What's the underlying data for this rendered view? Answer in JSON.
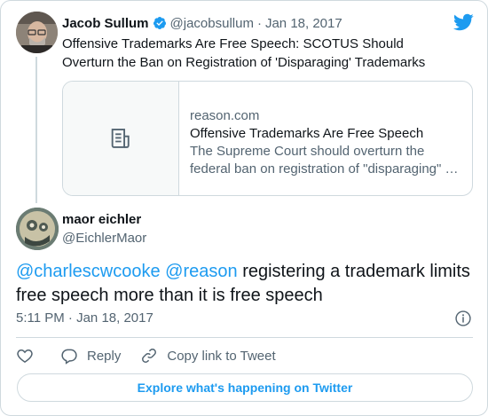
{
  "parent_tweet": {
    "author_name": "Jacob Sullum",
    "handle": "@jacobsullum",
    "separator": "·",
    "date": "Jan 18, 2017",
    "text": "Offensive Trademarks Are Free Speech: SCOTUS Should Overturn the Ban on Registration of 'Disparaging' Trademarks",
    "verified": true,
    "link_card": {
      "domain": "reason.com",
      "title": "Offensive Trademarks Are Free Speech",
      "description_line1": "The Supreme Court should overturn the",
      "description_line2": "federal ban on registration of \"disparaging\" …",
      "thumbnail_icon": "article-icon"
    }
  },
  "main_tweet": {
    "author_name": "maor eichler",
    "handle": "@EichlerMaor",
    "mentions": [
      "@charlescwcooke",
      "@reason"
    ],
    "text": "registering a trademark limits free speech more than it is free speech",
    "time": "5:11 PM",
    "separator": "·",
    "date": "Jan 18, 2017"
  },
  "actions": {
    "like_icon": "heart-icon",
    "reply_label": "Reply",
    "copy_link_label": "Copy link to Tweet"
  },
  "footer": {
    "explore_label": "Explore what's happening on Twitter"
  },
  "colors": {
    "accent": "#1d9bf0",
    "text": "#0f1419",
    "secondary": "#536471",
    "border": "#cfd9de"
  }
}
